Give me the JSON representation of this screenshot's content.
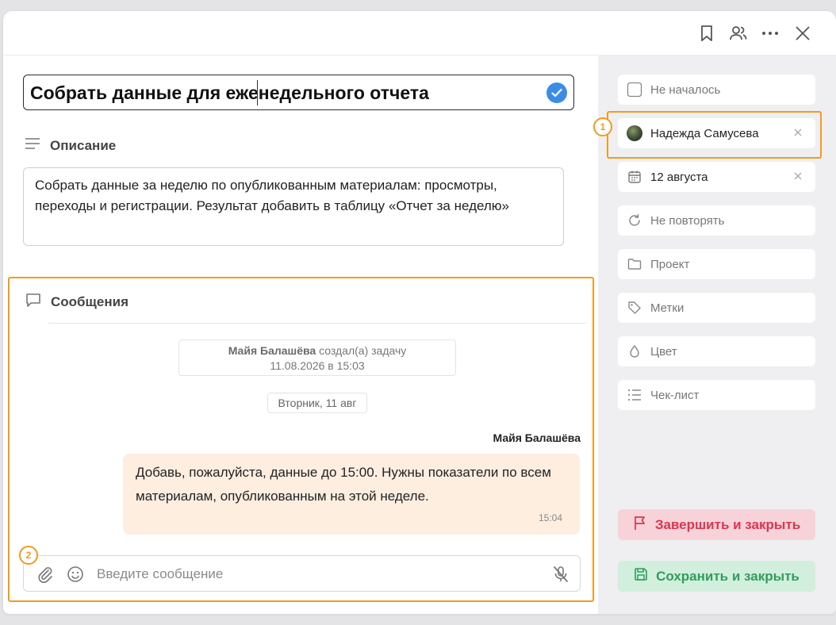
{
  "colors": {
    "accent": "#3c8ce7",
    "highlight": "#f29b1e",
    "danger": "#e0334f",
    "success": "#2f9e5d"
  },
  "toolbar": {
    "icons": [
      "bookmark-icon",
      "users-icon",
      "more-icon",
      "close-icon"
    ]
  },
  "task": {
    "title": "Собрать данные для еженедельного отчета"
  },
  "description": {
    "heading": "Описание",
    "text": "Собрать данные за неделю по опубликованным материалам: просмотры, переходы и регистрации. Результат добавить в таблицу «Отчет за неделю»"
  },
  "messages": {
    "heading": "Сообщения",
    "system": {
      "author": "Майя Балашёва",
      "action": " создал(а) задачу",
      "datetime": "11.08.2026 в 15:03"
    },
    "date_chip": "Вторник, 11 авг",
    "items": [
      {
        "author": "Майя Балашёва",
        "text": "Добавь, пожалуйста, данные до 15:00. Нужны показатели по всем материалам, опубликованным на этой неделе.",
        "time": "15:04"
      }
    ],
    "composer": {
      "placeholder": "Введите сообщение",
      "value": ""
    }
  },
  "annotations": {
    "badge1": "1",
    "badge2": "2"
  },
  "sidebar": {
    "status": "Не началось",
    "assignee": "Надежда Самусева",
    "due_date": "12 августа",
    "repeat": "Не повторять",
    "project": "Проект",
    "tags": "Метки",
    "color": "Цвет",
    "checklist": "Чек-лист",
    "complete_button": "Завершить и закрыть",
    "save_button": "Сохранить и закрыть"
  }
}
